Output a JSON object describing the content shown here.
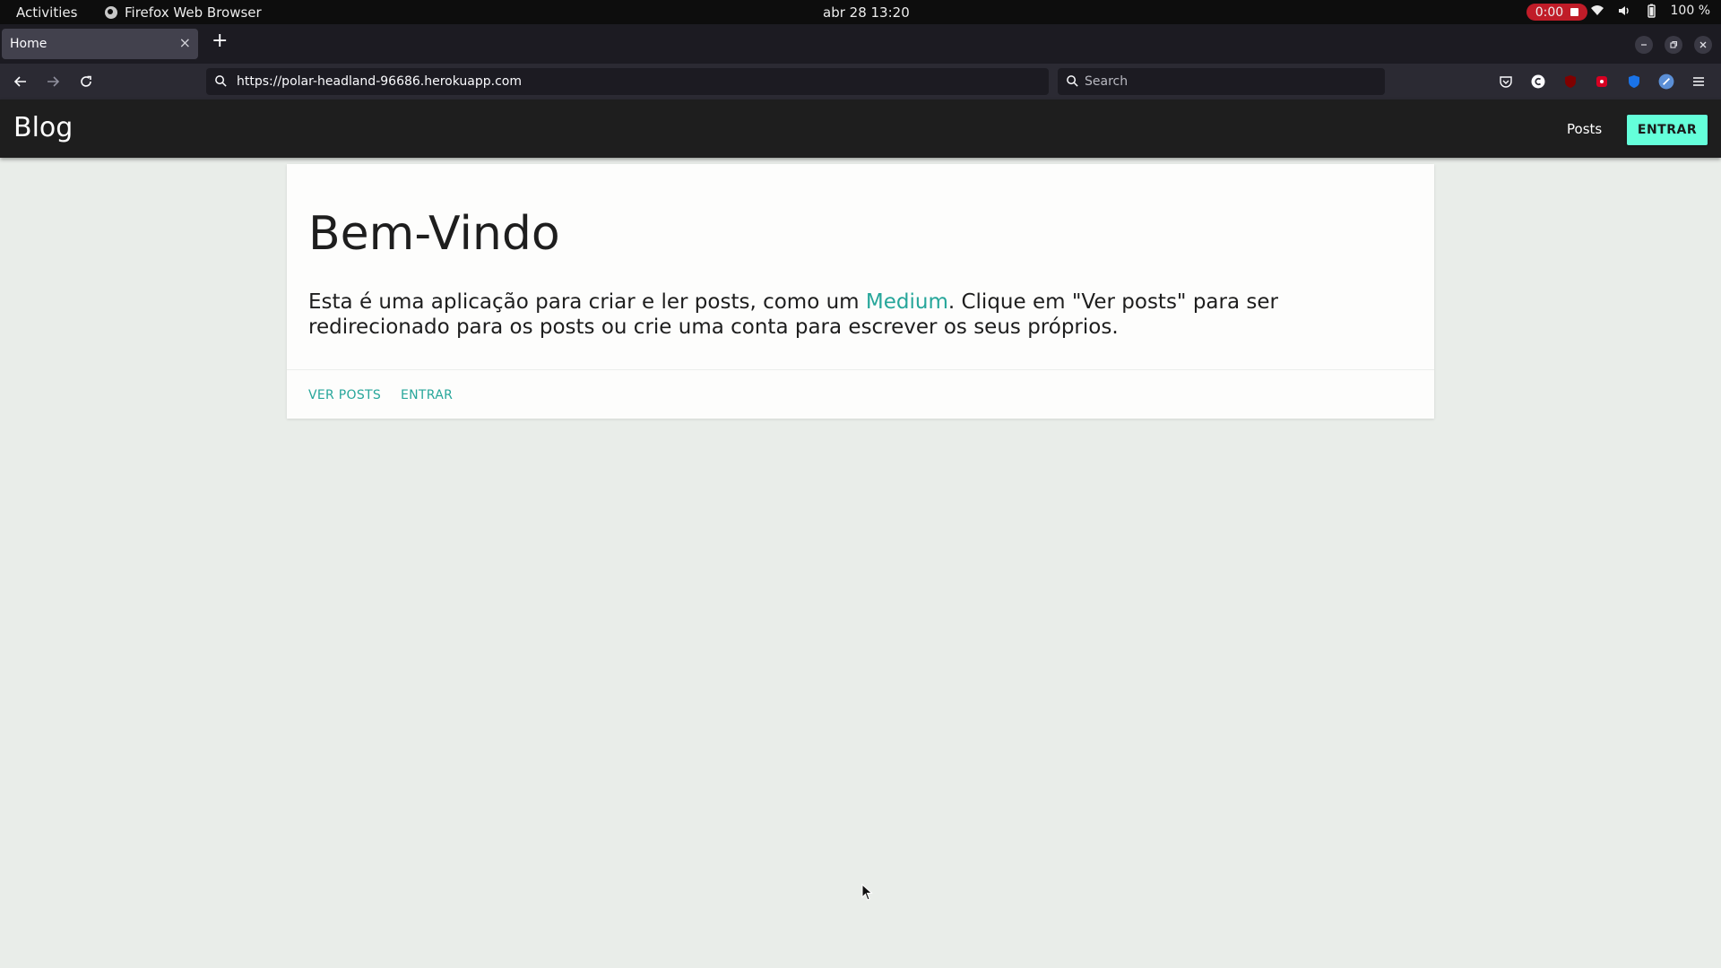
{
  "system_bar": {
    "activities": "Activities",
    "app_name": "Firefox Web Browser",
    "clock": "abr 28  13:20",
    "recording_time": "0:00",
    "battery": "100 %"
  },
  "browser": {
    "tab_title": "Home",
    "tab_close": "×",
    "new_tab": "+",
    "url": "https://polar-headland-96686.herokuapp.com",
    "search_placeholder": "Search"
  },
  "site": {
    "brand": "Blog",
    "nav_posts": "Posts",
    "nav_entrar": "ENTRAR"
  },
  "card": {
    "title": "Bem-Vindo",
    "description_before": "Esta é uma aplicação para criar e ler posts, como um ",
    "description_link": "Medium",
    "description_after": ". Clique em \"Ver posts\" para ser redirecionado para os posts ou crie uma conta para escrever os seus próprios.",
    "action_ver_posts": "VER POSTS",
    "action_entrar": "ENTRAR"
  },
  "colors": {
    "accent_teal": "#26a69a",
    "button_mint": "#64ffda",
    "appbar_dark": "#1e1e1e",
    "record_red": "#c01c28"
  }
}
